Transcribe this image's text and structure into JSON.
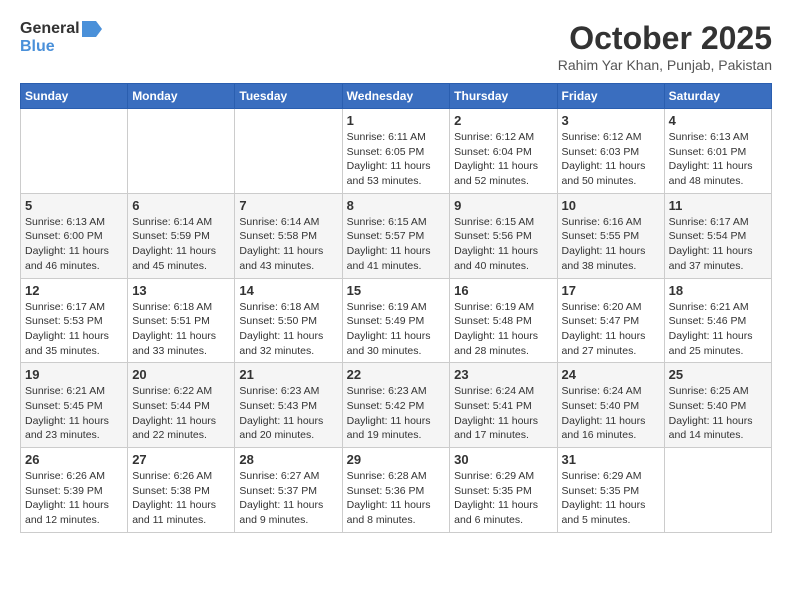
{
  "header": {
    "logo_line1": "General",
    "logo_line2": "Blue",
    "month_title": "October 2025",
    "location": "Rahim Yar Khan, Punjab, Pakistan"
  },
  "weekdays": [
    "Sunday",
    "Monday",
    "Tuesday",
    "Wednesday",
    "Thursday",
    "Friday",
    "Saturday"
  ],
  "weeks": [
    [
      {
        "day": "",
        "info": ""
      },
      {
        "day": "",
        "info": ""
      },
      {
        "day": "",
        "info": ""
      },
      {
        "day": "1",
        "info": "Sunrise: 6:11 AM\nSunset: 6:05 PM\nDaylight: 11 hours\nand 53 minutes."
      },
      {
        "day": "2",
        "info": "Sunrise: 6:12 AM\nSunset: 6:04 PM\nDaylight: 11 hours\nand 52 minutes."
      },
      {
        "day": "3",
        "info": "Sunrise: 6:12 AM\nSunset: 6:03 PM\nDaylight: 11 hours\nand 50 minutes."
      },
      {
        "day": "4",
        "info": "Sunrise: 6:13 AM\nSunset: 6:01 PM\nDaylight: 11 hours\nand 48 minutes."
      }
    ],
    [
      {
        "day": "5",
        "info": "Sunrise: 6:13 AM\nSunset: 6:00 PM\nDaylight: 11 hours\nand 46 minutes."
      },
      {
        "day": "6",
        "info": "Sunrise: 6:14 AM\nSunset: 5:59 PM\nDaylight: 11 hours\nand 45 minutes."
      },
      {
        "day": "7",
        "info": "Sunrise: 6:14 AM\nSunset: 5:58 PM\nDaylight: 11 hours\nand 43 minutes."
      },
      {
        "day": "8",
        "info": "Sunrise: 6:15 AM\nSunset: 5:57 PM\nDaylight: 11 hours\nand 41 minutes."
      },
      {
        "day": "9",
        "info": "Sunrise: 6:15 AM\nSunset: 5:56 PM\nDaylight: 11 hours\nand 40 minutes."
      },
      {
        "day": "10",
        "info": "Sunrise: 6:16 AM\nSunset: 5:55 PM\nDaylight: 11 hours\nand 38 minutes."
      },
      {
        "day": "11",
        "info": "Sunrise: 6:17 AM\nSunset: 5:54 PM\nDaylight: 11 hours\nand 37 minutes."
      }
    ],
    [
      {
        "day": "12",
        "info": "Sunrise: 6:17 AM\nSunset: 5:53 PM\nDaylight: 11 hours\nand 35 minutes."
      },
      {
        "day": "13",
        "info": "Sunrise: 6:18 AM\nSunset: 5:51 PM\nDaylight: 11 hours\nand 33 minutes."
      },
      {
        "day": "14",
        "info": "Sunrise: 6:18 AM\nSunset: 5:50 PM\nDaylight: 11 hours\nand 32 minutes."
      },
      {
        "day": "15",
        "info": "Sunrise: 6:19 AM\nSunset: 5:49 PM\nDaylight: 11 hours\nand 30 minutes."
      },
      {
        "day": "16",
        "info": "Sunrise: 6:19 AM\nSunset: 5:48 PM\nDaylight: 11 hours\nand 28 minutes."
      },
      {
        "day": "17",
        "info": "Sunrise: 6:20 AM\nSunset: 5:47 PM\nDaylight: 11 hours\nand 27 minutes."
      },
      {
        "day": "18",
        "info": "Sunrise: 6:21 AM\nSunset: 5:46 PM\nDaylight: 11 hours\nand 25 minutes."
      }
    ],
    [
      {
        "day": "19",
        "info": "Sunrise: 6:21 AM\nSunset: 5:45 PM\nDaylight: 11 hours\nand 23 minutes."
      },
      {
        "day": "20",
        "info": "Sunrise: 6:22 AM\nSunset: 5:44 PM\nDaylight: 11 hours\nand 22 minutes."
      },
      {
        "day": "21",
        "info": "Sunrise: 6:23 AM\nSunset: 5:43 PM\nDaylight: 11 hours\nand 20 minutes."
      },
      {
        "day": "22",
        "info": "Sunrise: 6:23 AM\nSunset: 5:42 PM\nDaylight: 11 hours\nand 19 minutes."
      },
      {
        "day": "23",
        "info": "Sunrise: 6:24 AM\nSunset: 5:41 PM\nDaylight: 11 hours\nand 17 minutes."
      },
      {
        "day": "24",
        "info": "Sunrise: 6:24 AM\nSunset: 5:40 PM\nDaylight: 11 hours\nand 16 minutes."
      },
      {
        "day": "25",
        "info": "Sunrise: 6:25 AM\nSunset: 5:40 PM\nDaylight: 11 hours\nand 14 minutes."
      }
    ],
    [
      {
        "day": "26",
        "info": "Sunrise: 6:26 AM\nSunset: 5:39 PM\nDaylight: 11 hours\nand 12 minutes."
      },
      {
        "day": "27",
        "info": "Sunrise: 6:26 AM\nSunset: 5:38 PM\nDaylight: 11 hours\nand 11 minutes."
      },
      {
        "day": "28",
        "info": "Sunrise: 6:27 AM\nSunset: 5:37 PM\nDaylight: 11 hours\nand 9 minutes."
      },
      {
        "day": "29",
        "info": "Sunrise: 6:28 AM\nSunset: 5:36 PM\nDaylight: 11 hours\nand 8 minutes."
      },
      {
        "day": "30",
        "info": "Sunrise: 6:29 AM\nSunset: 5:35 PM\nDaylight: 11 hours\nand 6 minutes."
      },
      {
        "day": "31",
        "info": "Sunrise: 6:29 AM\nSunset: 5:35 PM\nDaylight: 11 hours\nand 5 minutes."
      },
      {
        "day": "",
        "info": ""
      }
    ]
  ]
}
